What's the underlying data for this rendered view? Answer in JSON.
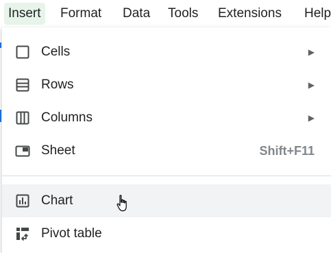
{
  "menubar": {
    "items": [
      {
        "label": "Insert"
      },
      {
        "label": "Format"
      },
      {
        "label": "Data"
      },
      {
        "label": "Tools"
      },
      {
        "label": "Extensions"
      },
      {
        "label": "Help"
      }
    ],
    "active_item": "Insert",
    "active_color": "#e6f4ea"
  },
  "insert_menu": {
    "items": [
      {
        "label": "Cells",
        "icon": "cells-icon",
        "submenu_arrow": "▶"
      },
      {
        "label": "Rows",
        "icon": "rows-icon",
        "submenu_arrow": "▶"
      },
      {
        "label": "Columns",
        "icon": "columns-icon",
        "submenu_arrow": "▶"
      },
      {
        "label": "Sheet",
        "icon": "sheet-icon",
        "shortcut": "Shift+F11"
      },
      {
        "label": "Chart",
        "icon": "chart-icon",
        "hovered": true
      },
      {
        "label": "Pivot table",
        "icon": "pivot-table-icon"
      }
    ],
    "hover_color": "#f1f3f4"
  }
}
